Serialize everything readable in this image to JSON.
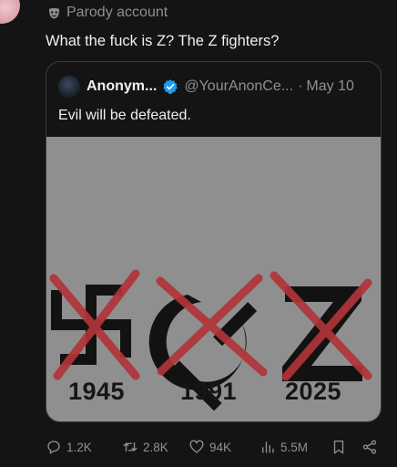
{
  "header": {
    "badge_label": "Parody account",
    "badge_icon": "mask-icon"
  },
  "tweet": {
    "text": "What the fuck is Z? The Z fighters?"
  },
  "quote": {
    "name": "Anonym...",
    "handle": "@YourAnonCe...",
    "separator": "·",
    "date": "May 10",
    "text": "Evil will be defeated.",
    "verified_color": "#1d9bf0",
    "image": {
      "symbols": [
        "swastika-icon",
        "hammer-sickle-icon",
        "z-letter-icon"
      ],
      "years": [
        "1945",
        "1991",
        "2025"
      ],
      "cross_color": "#b0343a"
    }
  },
  "actions": {
    "replies": "1.2K",
    "reposts": "2.8K",
    "likes": "94K",
    "views": "5.5M"
  }
}
